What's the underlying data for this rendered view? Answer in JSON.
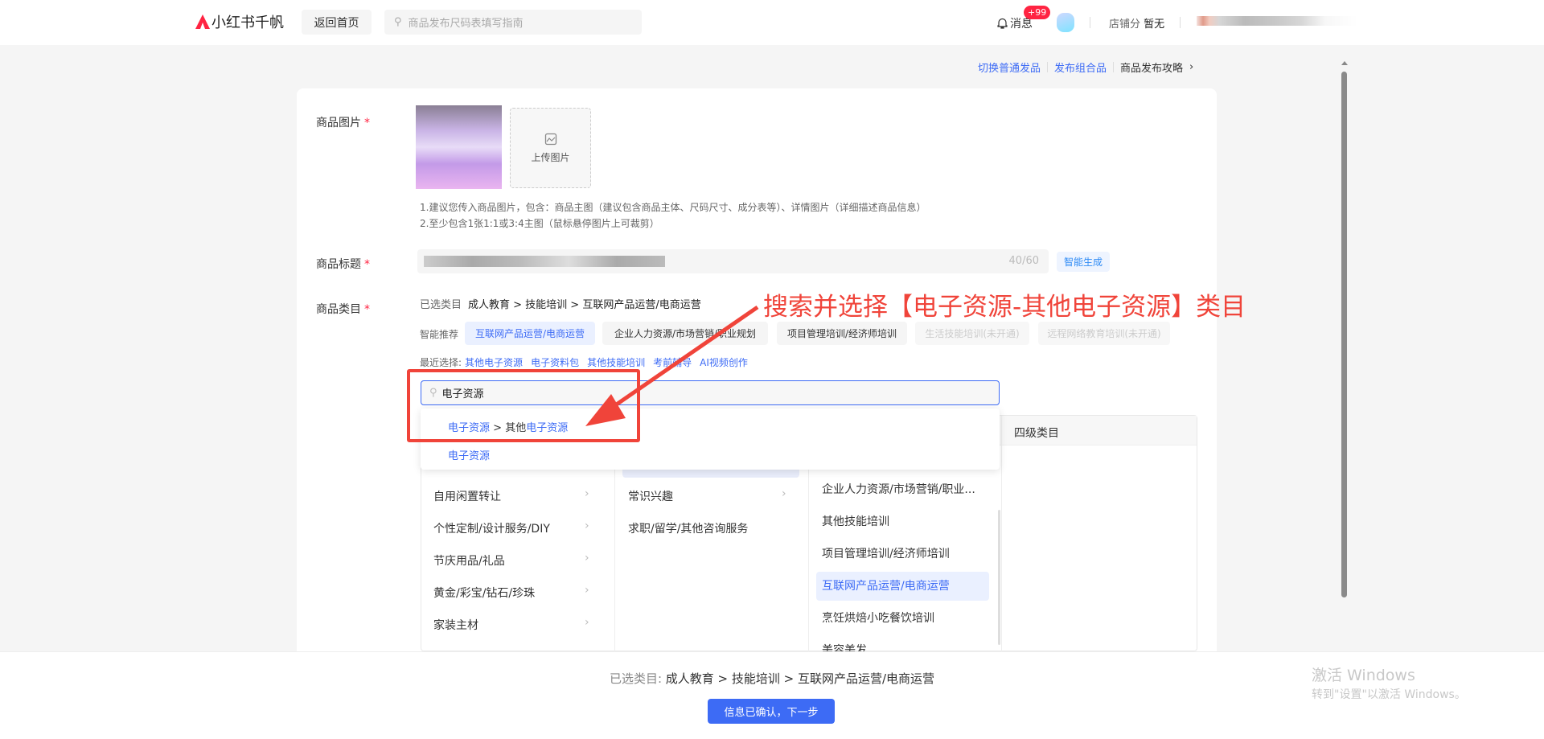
{
  "header": {
    "logo_text": "小红书千帆",
    "home_button": "返回首页",
    "search_placeholder": "商品发布尺码表填写指南",
    "messages_label": "消息",
    "messages_badge": "+99",
    "shop_score_label": "店铺分",
    "shop_score_value": "暂无"
  },
  "top_links": {
    "switch_normal": "切换普通发品",
    "publish_combo": "发布组合品",
    "guide": "商品发布攻略"
  },
  "form": {
    "images": {
      "label": "商品图片",
      "required": "*",
      "upload_label": "上传图片",
      "hint1": "1.建议您传入商品图片，包含：商品主图（建议包含商品主体、尺码尺寸、成分表等）、详情图片（详细描述商品信息）",
      "hint2": "2.至少包含1张1:1或3:4主图（鼠标悬停图片上可裁剪）"
    },
    "title": {
      "label": "商品标题",
      "required": "*",
      "counter": "40/60",
      "ai_button": "智能生成"
    },
    "category": {
      "label": "商品类目",
      "required": "*",
      "selected_label": "已选类目",
      "selected_path": "成人教育 > 技能培训 > 互联网产品运营/电商运营",
      "smart_label": "智能推荐",
      "smart_chips": [
        {
          "label": "互联网产品运营/电商运营",
          "state": "active"
        },
        {
          "label": "企业人力资源/市场营销/职业规划",
          "state": "normal"
        },
        {
          "label": "项目管理培训/经济师培训",
          "state": "normal"
        },
        {
          "label": "生活技能培训(未开通)",
          "state": "disabled"
        },
        {
          "label": "远程网络教育培训(未开通)",
          "state": "disabled"
        }
      ],
      "recent_label": "最近选择:",
      "recent": [
        "其他电子资源",
        "电子资料包",
        "其他技能培训",
        "考前辅导",
        "AI视频创作"
      ],
      "search_value": "电子资源",
      "suggestions": [
        {
          "prefix": "电子资源",
          "sep": " > ",
          "mid": "其他",
          "suffix": "电子资源"
        },
        {
          "prefix": "电子资源"
        }
      ],
      "level4_header": "四级类目",
      "col1": [
        "自用闲置转让",
        "个性定制/设计服务/DIY",
        "节庆用品/礼品",
        "黄金/彩宝/钻石/珍珠",
        "家装主材"
      ],
      "col2": [
        "常识兴趣",
        "求职/留学/其他咨询服务"
      ],
      "col3": [
        "企业人力资源/市场营销/职业...",
        "其他技能培训",
        "项目管理培训/经济师培训",
        "互联网产品运营/电商运营",
        "烹饪烘焙小吃餐饮培训",
        "美容美发"
      ]
    }
  },
  "annotation": "搜索并选择【电子资源-其他电子资源】类目",
  "footer": {
    "selected_label": "已选类目:",
    "selected_path": "成人教育 > 技能培训 > 互联网产品运营/电商运营",
    "next_button": "信息已确认，下一步"
  },
  "watermark": {
    "line1": "激活 Windows",
    "line2": "转到\"设置\"以激活 Windows。"
  },
  "colors": {
    "brand": "#ff2442",
    "accent": "#3d6bf5",
    "annotation": "#f0443a"
  }
}
